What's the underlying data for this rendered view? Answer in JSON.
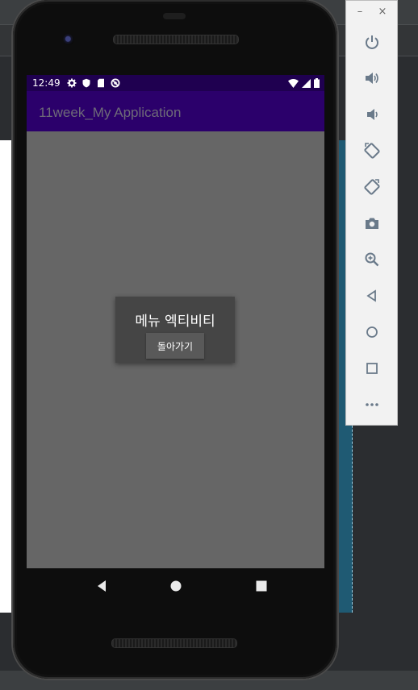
{
  "status_bar": {
    "time": "12:49",
    "left_icons": [
      "gear-icon",
      "shield-icon",
      "sd-card-icon",
      "no-sync-icon"
    ],
    "right_icons": [
      "wifi-icon",
      "signal-icon",
      "battery-icon"
    ]
  },
  "app": {
    "title": "11week_My Application",
    "colors": {
      "status_bar": "#1f0050",
      "app_bar": "#2b006b",
      "content": "#666666"
    }
  },
  "dialog": {
    "title": "메뉴 엑티비티",
    "button_label": "돌아가기"
  },
  "nav": [
    "back-icon",
    "home-icon",
    "recents-icon"
  ],
  "emulator_toolbar": {
    "window_controls": {
      "minimize": "–",
      "close": "×"
    },
    "buttons": [
      "power-icon",
      "volume-up-icon",
      "volume-down-icon",
      "rotate-left-icon",
      "rotate-right-icon",
      "screenshot-icon",
      "zoom-icon",
      "back-icon",
      "home-icon",
      "overview-icon",
      "more-icon"
    ]
  }
}
